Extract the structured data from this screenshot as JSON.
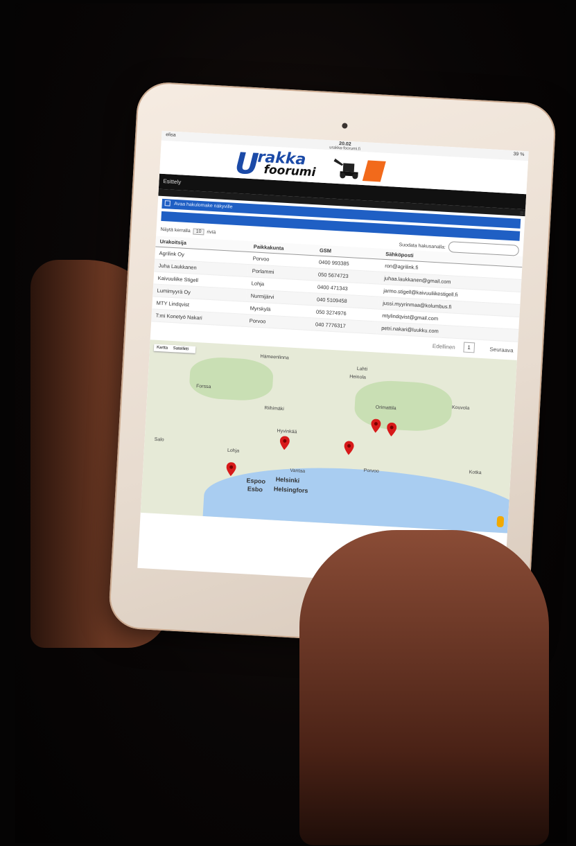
{
  "status": {
    "carrier": "elisa",
    "time": "20.02",
    "url": "urakka-foorumi.fi",
    "battery": "39 %"
  },
  "logo": {
    "u": "U",
    "rakka": "rakka",
    "foorumi": "foorumi"
  },
  "nav": {
    "label": "Esittely"
  },
  "search": {
    "toggle_label": "Avaa hakulomake näkyville"
  },
  "controls": {
    "show_prefix": "Näytä kerralla",
    "page_size": "10",
    "show_suffix": "riviä",
    "filter_label": "Suodata hakusanalla:"
  },
  "table": {
    "headers": [
      "Urakoitsija",
      "Paikkakunta",
      "GSM",
      "Sähköposti"
    ],
    "rows": [
      [
        "Agrilink Oy",
        "Porvoo",
        "0400 993385",
        "ron@agrilink.fi"
      ],
      [
        "Juha Laukkanen",
        "Porlammi",
        "050 5674723",
        "juhaa.laukkanen@gmail.com"
      ],
      [
        "Kaivuuliike Stigell",
        "Lohja",
        "0400 471343",
        "jarmo.stigell@kaivuuliikestigell.fi"
      ],
      [
        "Lumimyyrä Oy",
        "Nurmijärvi",
        "040 5109458",
        "jussi.myyrinmaa@kolumbus.fi"
      ],
      [
        "MTY Lindqvist",
        "Myrskylä",
        "050 3274976",
        "mtylindqvist@gmail.com"
      ],
      [
        "T:mi Konetyö Nakari",
        "Porvoo",
        "040 7776317",
        "petri.nakari@luukku.com"
      ]
    ]
  },
  "pager": {
    "prev": "Edellinen",
    "page": "1",
    "next": "Seuraava"
  },
  "map": {
    "tabs": [
      "Kartta",
      "Satelliitti"
    ],
    "cities": [
      "Hämeenlinna",
      "Lahti",
      "Heinola",
      "Kouvola",
      "Forssa",
      "Riihimäki",
      "Hyvinkää",
      "Salo",
      "Vantaa",
      "Porvoo",
      "Kotka",
      "Lohja",
      "Orimattila"
    ],
    "big_cities": [
      "Espoo",
      "Esbo",
      "Helsinki",
      "Helsingfors"
    ]
  }
}
